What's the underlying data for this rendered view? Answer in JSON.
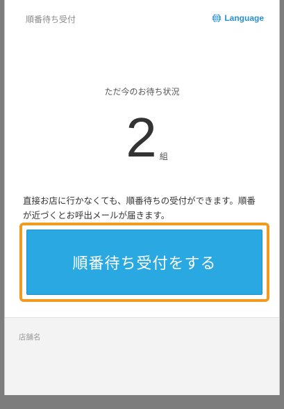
{
  "header": {
    "title": "順番待ち受付",
    "language_label": "Language",
    "language_icon": "globe-icon"
  },
  "status": {
    "label": "ただ今のお待ち状況",
    "count": "2",
    "unit": "組"
  },
  "description": "直接お店に行かなくても、順番待ちの受付ができます。順番が近づくとお呼出メールが届きます。",
  "cta": {
    "label": "順番待ち受付をする"
  },
  "store": {
    "label": "店舗名"
  },
  "colors": {
    "accent": "#2aa8e2",
    "highlight": "#f29a1e",
    "link": "#2a8fd0"
  }
}
